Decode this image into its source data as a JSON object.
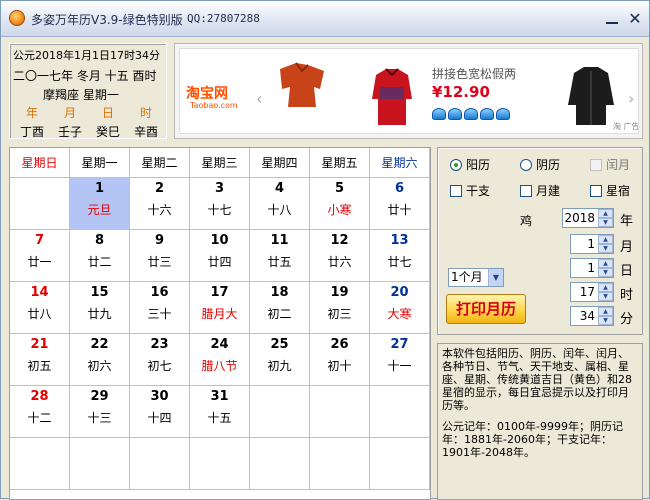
{
  "window": {
    "title": "多姿万年历V3.9-绿色特别版",
    "qq": "QQ:27807288"
  },
  "info": {
    "solar": "公元2018年1月1日17时34分",
    "lunar": "二〇一七年 冬月 十五 酉时",
    "constellation": "摩羯座   星期一",
    "ganzhi_labels": [
      "年",
      "月",
      "日",
      "时"
    ],
    "ganzhi_values": [
      "丁酉",
      "壬子",
      "癸巳",
      "辛酉"
    ]
  },
  "ad": {
    "logo": "淘宝网",
    "logo_sub": "Taobao.com",
    "product_name": "拼接色宽松假两",
    "price": "¥12.90",
    "tag": "淘 广告",
    "arrow_left": "‹",
    "arrow_right": "›"
  },
  "calendar": {
    "weekdays": [
      "星期日",
      "星期一",
      "星期二",
      "星期三",
      "星期四",
      "星期五",
      "星期六"
    ],
    "weeks": [
      [
        null,
        {
          "d": "1",
          "l": "元旦",
          "hl": true,
          "lc": "red"
        },
        {
          "d": "2",
          "l": "十六"
        },
        {
          "d": "3",
          "l": "十七"
        },
        {
          "d": "4",
          "l": "十八"
        },
        {
          "d": "5",
          "l": "小寒",
          "lc": "red"
        },
        {
          "d": "6",
          "l": "廿十"
        }
      ],
      [
        {
          "d": "7",
          "l": "廿一"
        },
        {
          "d": "8",
          "l": "廿二"
        },
        {
          "d": "9",
          "l": "廿三"
        },
        {
          "d": "10",
          "l": "廿四"
        },
        {
          "d": "11",
          "l": "廿五"
        },
        {
          "d": "12",
          "l": "廿六"
        },
        {
          "d": "13",
          "l": "廿七"
        }
      ],
      [
        {
          "d": "14",
          "l": "廿八"
        },
        {
          "d": "15",
          "l": "廿九"
        },
        {
          "d": "16",
          "l": "三十"
        },
        {
          "d": "17",
          "l": "腊月大",
          "lc": "red"
        },
        {
          "d": "18",
          "l": "初二"
        },
        {
          "d": "19",
          "l": "初三"
        },
        {
          "d": "20",
          "l": "大寒",
          "lc": "red"
        }
      ],
      [
        {
          "d": "21",
          "l": "初五"
        },
        {
          "d": "22",
          "l": "初六"
        },
        {
          "d": "23",
          "l": "初七"
        },
        {
          "d": "24",
          "l": "腊八节",
          "lc": "red"
        },
        {
          "d": "25",
          "l": "初九"
        },
        {
          "d": "26",
          "l": "初十"
        },
        {
          "d": "27",
          "l": "十一"
        }
      ],
      [
        {
          "d": "28",
          "l": "十二"
        },
        {
          "d": "29",
          "l": "十三"
        },
        {
          "d": "30",
          "l": "十四"
        },
        {
          "d": "31",
          "l": "十五"
        },
        null,
        null,
        null
      ],
      [
        null,
        null,
        null,
        null,
        null,
        null,
        null
      ]
    ]
  },
  "settings": {
    "radio_solar": "阳历",
    "radio_lunar": "阴历",
    "check_leap": "闰月",
    "check_ganzhi": "干支",
    "check_yuejian": "月建",
    "check_xingxiu": "星宿",
    "zodiac": "鸡",
    "year": "2018",
    "year_unit": "年",
    "month": "1",
    "month_unit": "月",
    "day": "1",
    "day_unit": "日",
    "hour": "17",
    "hour_unit": "时",
    "minute": "34",
    "minute_unit": "分",
    "range_selected": "1个月",
    "print_label": "打印月历"
  },
  "description": {
    "p1": "本软件包括阳历、阴历、闰年、闰月、各种节日、节气、天干地支、属相、星座、星期、传统黄道吉日（黄色）和28星宿的显示，每日宜忌提示以及打印月历等。",
    "p2": "公元记年：0100年-9999年；阴历记年：1881年-2060年；干支记年：1901年-2048年。"
  },
  "colors": {
    "weekend_red": "#e00000",
    "saturday_blue": "#00309c",
    "selected_bg": "#b4c4f4"
  }
}
